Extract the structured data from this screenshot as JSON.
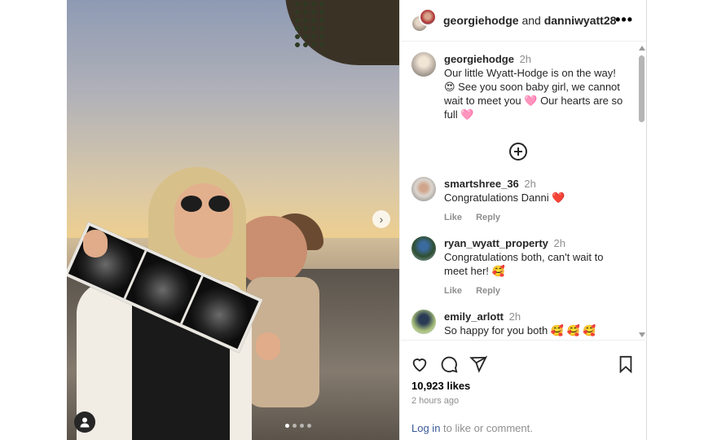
{
  "post": {
    "header": {
      "author_primary": "georgiehodge",
      "connector": "and",
      "author_secondary": "danniwyatt28",
      "more_icon": "more-horizontal-icon"
    },
    "caption": {
      "user": "georgiehodge",
      "time": "2h",
      "text": "Our little Wyatt-Hodge is on the way! 😍 See you soon baby girl, we cannot wait to meet you 🩷 Our hearts are so full 🩷"
    },
    "comments": [
      {
        "user": "smartshree_36",
        "time": "2h",
        "text": "Congratulations Danni ❤️",
        "like": "Like",
        "reply": "Reply"
      },
      {
        "user": "ryan_wyatt_property",
        "time": "2h",
        "text": "Congratulations both, can't wait to meet her! 🥰",
        "like": "Like",
        "reply": "Reply"
      },
      {
        "user": "emily_arlott",
        "time": "2h",
        "text": "So happy for you both 🥰 🥰 🥰"
      }
    ],
    "likes": "10,923 likes",
    "time_ago": "2 hours ago",
    "login_link": "Log in",
    "login_rest": " to like or comment.",
    "carousel": {
      "slide_count": 4,
      "current": 1
    },
    "icons": [
      "heart-icon",
      "comment-icon",
      "share-icon",
      "bookmark-icon",
      "chevron-right-icon",
      "user-tag-icon",
      "plus-circle-icon"
    ]
  }
}
